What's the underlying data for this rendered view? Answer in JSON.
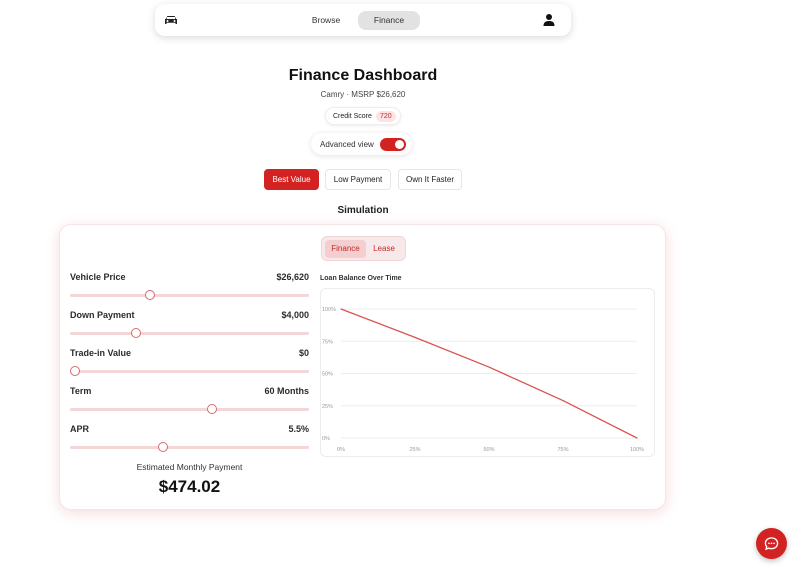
{
  "nav": {
    "tabs": [
      {
        "label": "Browse"
      },
      {
        "label": "Finance"
      }
    ],
    "active_tab": "Finance",
    "left_icon": "car-icon",
    "right_icon": "user-icon"
  },
  "header": {
    "title": "Finance Dashboard",
    "subtitle": "Camry · MSRP $26,620",
    "credit_label": "Credit Score",
    "credit_value": "720"
  },
  "advanced": {
    "label": "Advanced view",
    "enabled": true
  },
  "presets": [
    {
      "label": "Best Value",
      "active": true
    },
    {
      "label": "Low Payment",
      "active": false
    },
    {
      "label": "Own It Faster",
      "active": false
    }
  ],
  "simulation": {
    "title": "Simulation",
    "modes": [
      {
        "label": "Finance",
        "active": true
      },
      {
        "label": "Lease",
        "active": false
      }
    ],
    "sliders": [
      {
        "label": "Vehicle Price",
        "value": "$26,620",
        "fraction": 0.335
      },
      {
        "label": "Down Payment",
        "value": "$4,000",
        "fraction": 0.275
      },
      {
        "label": "Trade-in Value",
        "value": "$0",
        "fraction": 0.02
      },
      {
        "label": "Term",
        "value": "60 Months",
        "fraction": 0.595
      },
      {
        "label": "APR",
        "value": "5.5%",
        "fraction": 0.39
      }
    ],
    "estimate_label": "Estimated Monthly Payment",
    "estimate_value": "$474.02"
  },
  "chart_data": {
    "type": "line",
    "title": "Loan Balance Over Time",
    "x_ticks": [
      "0%",
      "25%",
      "50%",
      "75%",
      "100%"
    ],
    "y_ticks": [
      "0%",
      "25%",
      "50%",
      "75%",
      "100%"
    ],
    "xlim": [
      0,
      100
    ],
    "ylim": [
      0,
      100
    ],
    "grid": true,
    "series": [
      {
        "x": [
          0,
          25,
          50,
          75,
          100
        ],
        "y": [
          100,
          78,
          55,
          29,
          0
        ],
        "color": "#d9534f"
      }
    ]
  },
  "fab": {
    "icon": "chat-icon"
  },
  "colors": {
    "accent": "#d32222",
    "accent_soft": "#fde3e3"
  }
}
